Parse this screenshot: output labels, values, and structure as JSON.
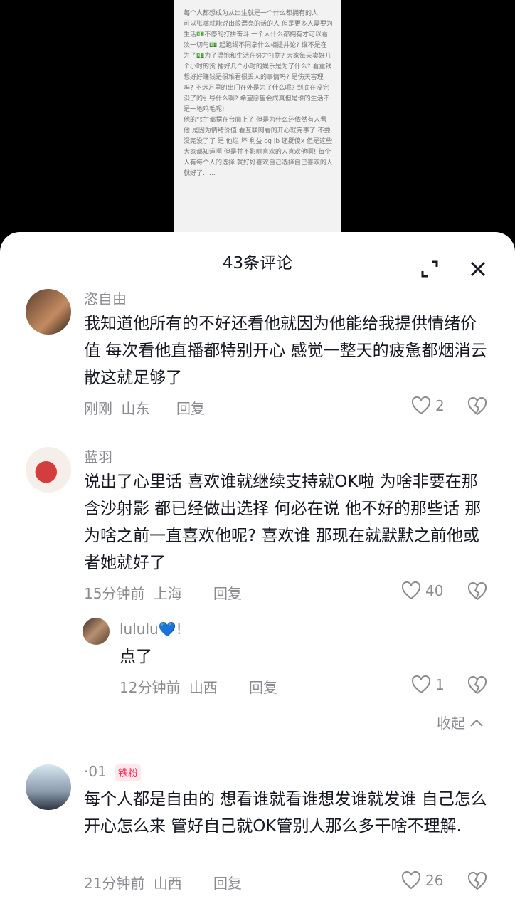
{
  "preview": {
    "text": "每个人都想成为从出生就是一个什么都拥有的人\n可以张嘴就能说出很漂亮的话的人 但是更多人需要为生活💵不停的打拼奋斗 一个人什么都拥有才可以看淡一切与💵 起跑线不同拿什么相提并论? 谁不是在为了💵为了温饱和生活在努力打拼? 大家每天卖好几个小时的货 播好几个小时的娱乐是为了什么? 看重钱想好好赚钱是很难看很丢人的事情吗? 是伤天害理吗? 不远万里的出门在外是为了什么呢? 到底在没完没了的引导什么啊? 希望愿望会成真但是谁的生活不是一地鸡毛呢!\n他的“烂”都摆在台面上了 但是为什么还依然有人看他 是因为情绪价值 看互联网看的开心就完事了 不要没完没了了 是 他烂 坏 利益 cg jb 还挺傻x 但是这些大家都知道啊 但是并不影响喜欢的人喜欢他啊! 每个人有每个人的选择 就好好喜欢自己选择自己喜欢的人就好了……"
  },
  "header": {
    "title": "43条评论"
  },
  "comments": [
    {
      "name": "恣自由",
      "text": "我知道他所有的不好还看他就因为他能给我提供情绪价值 每次看他直播都特别开心 感觉一整天的疲惫都烟消云散这就足够了",
      "time": "刚刚",
      "loc": "山东",
      "reply": "回复",
      "likes": "2"
    },
    {
      "name": "蓝羽",
      "text": "说出了心里话 喜欢谁就继续支持就OK啦 为啥非要在那含沙射影 都已经做出选择 何必在说 他不好的那些话 那为啥之前一直喜欢他呢? 喜欢谁 那现在就默默之前他或者她就好了",
      "time": "15分钟前",
      "loc": "上海",
      "reply": "回复",
      "likes": "40"
    },
    {
      "name": "lululu💙!",
      "text": "点了",
      "time": "12分钟前",
      "loc": "山西",
      "reply": "回复",
      "likes": "1"
    },
    {
      "name": "·01",
      "badge": "铁粉",
      "text": "每个人都是自由的 想看谁就看谁想发谁就发谁 自己怎么开心怎么来 管好自己就OK管别人那么多干啥不理解.",
      "time": "21分钟前",
      "loc": "山西",
      "reply": "回复",
      "likes": "26"
    }
  ],
  "collapse": {
    "label": "收起"
  },
  "colors": {
    "accent": "#fe2c55",
    "meta": "#8a8b91",
    "text": "#161823"
  },
  "icons": [
    "expand-icon",
    "close-icon",
    "heart-icon",
    "broken-heart-icon",
    "chevron-up-icon"
  ]
}
